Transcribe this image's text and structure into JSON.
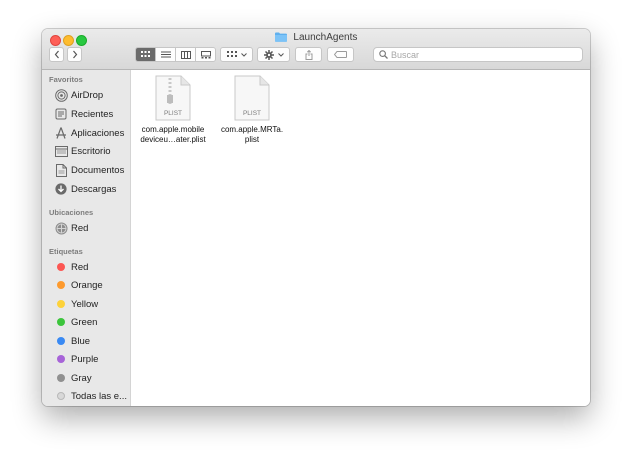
{
  "window": {
    "title": "LaunchAgents"
  },
  "toolbar": {
    "back_icon": "chevron-left-icon",
    "forward_icon": "chevron-right-icon",
    "view_modes": [
      "icon-view",
      "list-view",
      "column-view",
      "gallery-view"
    ],
    "group_icon": "group-icon",
    "action_icon": "gear-icon",
    "share_icon": "share-icon",
    "tag_icon": "tag-icon"
  },
  "search": {
    "placeholder": "Buscar"
  },
  "sidebar": {
    "favorites_title": "Favoritos",
    "favorites": [
      {
        "label": "AirDrop",
        "icon": "airdrop-icon"
      },
      {
        "label": "Recientes",
        "icon": "recents-icon"
      },
      {
        "label": "Aplicaciones",
        "icon": "applications-icon"
      },
      {
        "label": "Escritorio",
        "icon": "desktop-icon"
      },
      {
        "label": "Documentos",
        "icon": "documents-icon"
      },
      {
        "label": "Descargas",
        "icon": "downloads-icon"
      }
    ],
    "locations_title": "Ubicaciones",
    "locations": [
      {
        "label": "Red",
        "icon": "network-icon"
      }
    ],
    "tags_title": "Etiquetas",
    "tags": [
      {
        "label": "Red",
        "color": "#fc5753"
      },
      {
        "label": "Orange",
        "color": "#fd9a2e"
      },
      {
        "label": "Yellow",
        "color": "#fdd23a"
      },
      {
        "label": "Green",
        "color": "#3cc53c"
      },
      {
        "label": "Blue",
        "color": "#3a8af3"
      },
      {
        "label": "Purple",
        "color": "#a764d8"
      },
      {
        "label": "Gray",
        "color": "#909090"
      },
      {
        "label": "Todas las e...",
        "color": "#d8d8d8"
      }
    ]
  },
  "files": [
    {
      "line1": "com.apple.mobile",
      "line2": "deviceu…ater.plist",
      "badge": "PLIST"
    },
    {
      "line1": "com.apple.MRTa.",
      "line2": "plist",
      "badge": "PLIST"
    }
  ]
}
